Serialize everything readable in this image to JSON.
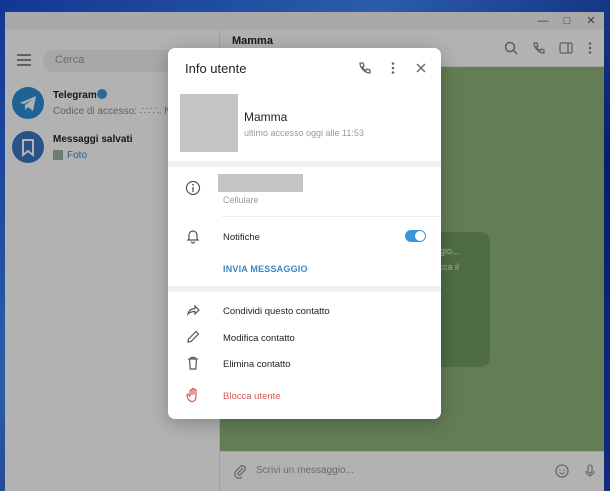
{
  "sidebar": {
    "search_placeholder": "Cerca",
    "chats": [
      {
        "name": "Telegram",
        "preview": "Codice di accesso: ∴∵∴. No",
        "verified": true,
        "icon": "telegram-plane-icon",
        "color": "#2a8fd6"
      },
      {
        "name": "Messaggi salvati",
        "preview": "Foto",
        "icon": "bookmark-icon",
        "color": "#3a78c0"
      }
    ]
  },
  "main": {
    "title": "Mamma",
    "bubble_lines": [
      "aggio...",
      "clicca il",
      "i"
    ],
    "composer_placeholder": "Scrivi un messaggio..."
  },
  "modal": {
    "title": "Info utente",
    "contact_name": "Mamma",
    "last_seen": "ultimo accesso oggi alle 11:53",
    "phone_label": "Cellulare",
    "notifications_label": "Notifiche",
    "notifications_on": true,
    "send_message": "INVIA MESSAGGIO",
    "actions": [
      {
        "label": "Condividi questo contatto",
        "icon": "share-arrow-icon"
      },
      {
        "label": "Modifica contatto",
        "icon": "pencil-icon"
      },
      {
        "label": "Elimina contatto",
        "icon": "trash-icon"
      },
      {
        "label": "Blocca utente",
        "icon": "hand-stop-icon"
      }
    ]
  },
  "colors": {
    "accent": "#3a98d6",
    "danger": "#d65a5a",
    "chat_bg": "#8fb57a"
  }
}
